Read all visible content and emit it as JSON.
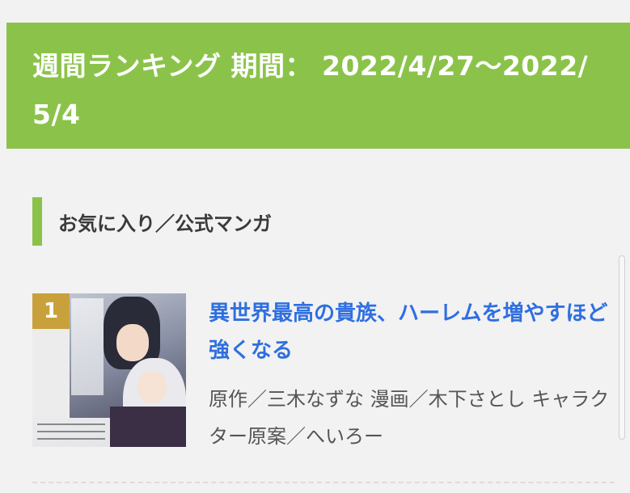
{
  "banner": {
    "title": "週間ランキング 期間： 2022/4/27〜2022/5/4"
  },
  "section": {
    "heading": "お気に入り／公式マンガ"
  },
  "items": [
    {
      "volume": "1",
      "title": "異世界最高の貴族、ハーレムを増やすほど強くなる",
      "credits": "原作／三木なずな 漫画／木下さとし キャラクター原案／へいろー"
    }
  ],
  "colors": {
    "accent": "#8bc34a",
    "link": "#2f6fe0",
    "background": "#f2f2f2"
  }
}
